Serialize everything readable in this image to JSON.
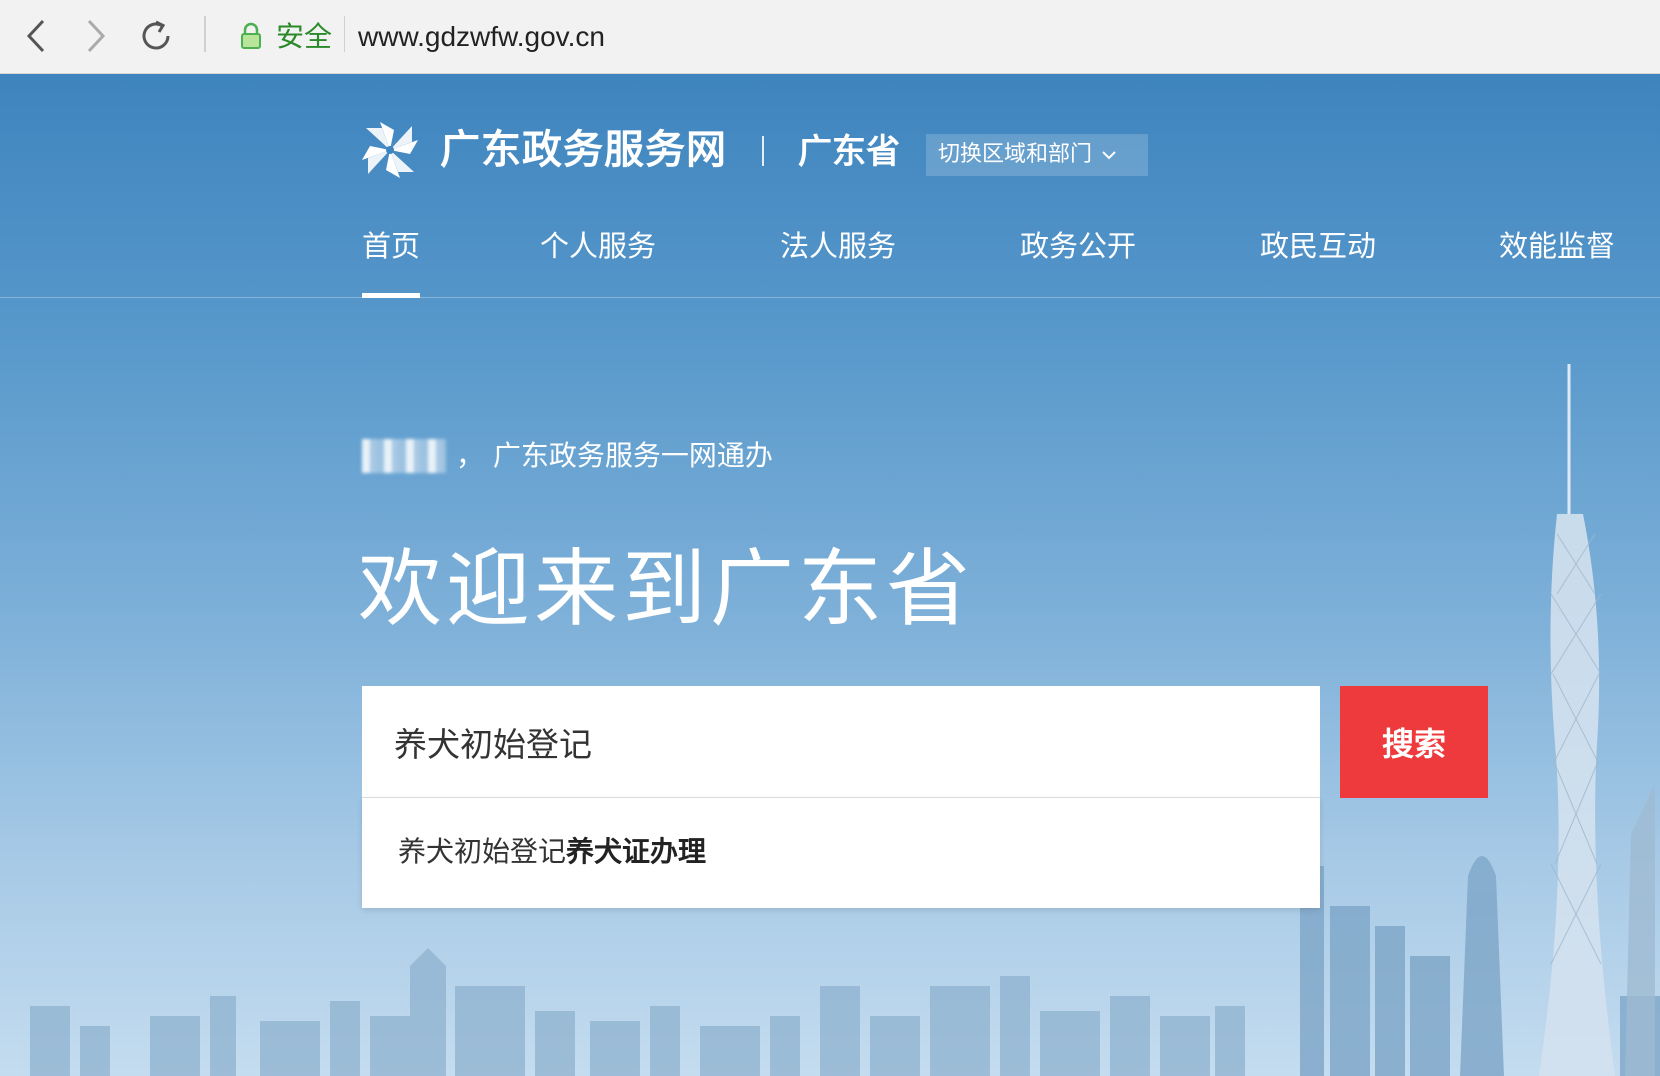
{
  "browser": {
    "secure_label": "安全",
    "url": "www.gdzwfw.gov.cn"
  },
  "header": {
    "site_title": "广东政务服务网",
    "region_name": "广东省",
    "region_switch_label": "切换区域和部门"
  },
  "nav": {
    "items": [
      {
        "label": "首页",
        "active": true
      },
      {
        "label": "个人服务"
      },
      {
        "label": "法人服务"
      },
      {
        "label": "政务公开"
      },
      {
        "label": "政民互动"
      },
      {
        "label": "效能监督"
      }
    ]
  },
  "hero": {
    "greeting_suffix": "， 广东政务服务一网通办",
    "welcome": "欢迎来到广东省"
  },
  "search": {
    "query": "养犬初始登记",
    "button_label": "搜索",
    "suggestion": {
      "prefix": "养犬初始登记",
      "highlight": "养犬证办理"
    }
  },
  "colors": {
    "accent_red": "#ee3a3d",
    "header_blue": "#3e84be",
    "secure_green": "#2a8a2a"
  }
}
